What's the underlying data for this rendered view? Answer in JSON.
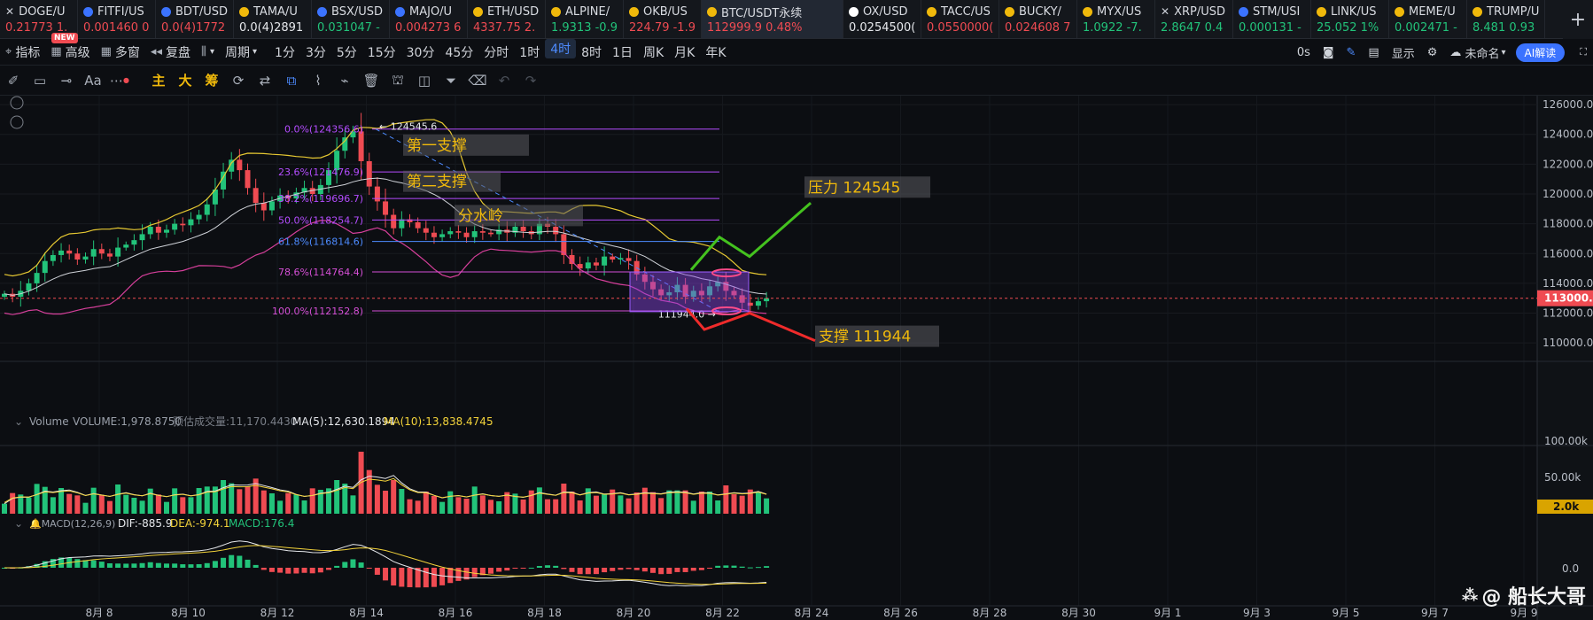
{
  "colors": {
    "up": "#ef4b52",
    "down": "#22c37a",
    "accent": "#3b73ff",
    "fib": "#b44cff",
    "fibBlue": "#4d8bff",
    "label": "#f0b90b",
    "ma5": "#e6e8ec",
    "ma10": "#f3d33a"
  },
  "ticker": [
    {
      "name": "DOGE/U",
      "price": "0.21773 1.",
      "dir": "dn",
      "color": "#ffffff",
      "close": true
    },
    {
      "name": "FITFI/US",
      "price": "0.001460 0",
      "dir": "dn",
      "color": "#3b73ff"
    },
    {
      "name": "BDT/USD",
      "price": "0.0(4)1772",
      "dir": "dn",
      "color": "#3b73ff"
    },
    {
      "name": "TAMA/U",
      "price": "0.0(4)2891",
      "dir": "fl",
      "color": "#f0b90b"
    },
    {
      "name": "BSX/USD",
      "price": "0.031047 -",
      "dir": "up",
      "color": "#3b73ff"
    },
    {
      "name": "MAJO/U",
      "price": "0.004273 6",
      "dir": "dn",
      "color": "#3b73ff"
    },
    {
      "name": "ETH/USD",
      "price": "4337.75 2.",
      "dir": "dn",
      "color": "#f0b90b"
    },
    {
      "name": "ALPINE/",
      "price": "1.9313 -0.9",
      "dir": "up",
      "color": "#f0b90b"
    },
    {
      "name": "OKB/US",
      "price": "224.79 -1.9",
      "dir": "dn",
      "color": "#f0b90b"
    },
    {
      "name": "BTC/USDT永续",
      "price": "112999.9 0.48%",
      "dir": "dn",
      "color": "#f0b90b",
      "active": true
    },
    {
      "name": "OX/USD",
      "price": "0.0254500(",
      "dir": "fl",
      "color": "#ffffff"
    },
    {
      "name": "TACC/US",
      "price": "0.0550000(",
      "dir": "dn",
      "color": "#f0b90b"
    },
    {
      "name": "BUCKY/",
      "price": "0.024608 7",
      "dir": "dn",
      "color": "#f0b90b"
    },
    {
      "name": "MYX/US",
      "price": "1.0922 -7.",
      "dir": "up",
      "color": "#f0b90b"
    },
    {
      "name": "XRP/USD",
      "price": "2.8647 0.4",
      "dir": "up",
      "color": "#ffffff",
      "close": true
    },
    {
      "name": "STM/USI",
      "price": "0.000131 -",
      "dir": "up",
      "color": "#3b73ff"
    },
    {
      "name": "LINK/US",
      "price": "25.052 1%",
      "dir": "up",
      "color": "#f0b90b"
    },
    {
      "name": "MEME/U",
      "price": "0.002471 -",
      "dir": "up",
      "color": "#f0b90b"
    },
    {
      "name": "TRUMP/U",
      "price": "8.481 0.93",
      "dir": "up",
      "color": "#f0b90b"
    }
  ],
  "toolbar1": {
    "indicator": "指标",
    "advanced": "高级",
    "multi": "多窗",
    "replay": "复盘",
    "period": "周期",
    "badge": "NEW",
    "intervals": [
      "1分",
      "3分",
      "5分",
      "15分",
      "30分",
      "45分",
      "分时",
      "1时",
      "4时",
      "8时",
      "1日",
      "周K",
      "月K",
      "年K"
    ],
    "selected": "4时",
    "right": {
      "zero_s": "0s",
      "display": "显示",
      "unnamed": "未命名",
      "ai": "AI解读"
    }
  },
  "toolbar2": {
    "text": "Aa",
    "zhu": "主",
    "da": "大",
    "chou": "筹"
  },
  "chart_data": {
    "type": "candlestick",
    "symbol": "BTC/USDT永续",
    "interval": "4时",
    "x_ticks": [
      "8月 8",
      "8月 10",
      "8月 12",
      "8月 14",
      "8月 16",
      "8月 18",
      "8月 20",
      "8月 22",
      "8月 24",
      "8月 26",
      "8月 28",
      "8月 30",
      "9月 1",
      "9月 3",
      "9月 5",
      "9月 7",
      "9月 9"
    ],
    "y_ticks": [
      "126000.0",
      "124000.0",
      "122000.0",
      "120000.0",
      "118000.0",
      "116000.0",
      "114000.0",
      "112000.0",
      "110000.0"
    ],
    "ylim": [
      109000,
      126600
    ],
    "last_price": "113000.0",
    "high_marker": "124545.6",
    "low_marker": "111944.0",
    "fib_levels": [
      {
        "label": "0.0%(124356.6)",
        "value": 124356.6
      },
      {
        "label": "23.6%(121476.9)",
        "value": 121476.9
      },
      {
        "label": "38.2%(119696.7)",
        "value": 119696.7
      },
      {
        "label": "50.0%(118254.7)",
        "value": 118254.7
      },
      {
        "label": "61.8%(116814.6)",
        "value": 116814.6
      },
      {
        "label": "78.6%(114764.4)",
        "value": 114764.4
      },
      {
        "label": "100.0%(112152.8)",
        "value": 112152.8
      }
    ],
    "annotations": {
      "support1": "第一支撑",
      "support2": "第二支撑",
      "watershed": "分水岭",
      "resistance": "压力 124545",
      "support": "支撑 111944"
    },
    "close_path": [
      113300,
      113100,
      113500,
      114000,
      114700,
      115500,
      115900,
      116200,
      116000,
      115600,
      115800,
      116300,
      116000,
      115800,
      116400,
      116600,
      116900,
      117300,
      117800,
      117400,
      117600,
      118000,
      117900,
      118300,
      118600,
      119300,
      120300,
      121500,
      122300,
      121600,
      120400,
      119400,
      118900,
      119500,
      119900,
      119700,
      120100,
      120400,
      120000,
      120600,
      121600,
      122900,
      123800,
      124200,
      122200,
      120500,
      119500,
      118600,
      117700,
      118300,
      118100,
      117700,
      117400,
      117100,
      117300,
      117500,
      117400,
      117100,
      117500,
      117400,
      117300,
      117600,
      117400,
      117800,
      117500,
      117300,
      118000,
      117800,
      117300,
      115900,
      115300,
      115000,
      115400,
      115200,
      115800,
      115600,
      115700,
      115500,
      114600,
      114100,
      113600,
      113200,
      113400,
      113900,
      113100,
      113500,
      113200,
      113800,
      114100,
      113500,
      113200,
      112700,
      112500,
      112800,
      113000
    ],
    "volume": {
      "label": "Volume",
      "value": "VOLUME:1,978.8750",
      "est": "预估成交量:11,170.4430",
      "ma5": "MA(5):12,630.1894",
      "ma10": "MA(10):13,838.4745",
      "y_ticks": [
        "100.00k",
        "50.00k"
      ],
      "last": "2.0k"
    },
    "macd": {
      "label": "MACD(12,26,9)",
      "dif": "DIF:-885.9",
      "dea": "DEA:-974.1",
      "macd": "MACD:176.4",
      "y_tick": "0.0"
    }
  },
  "watermark": "@ 船长大哥"
}
